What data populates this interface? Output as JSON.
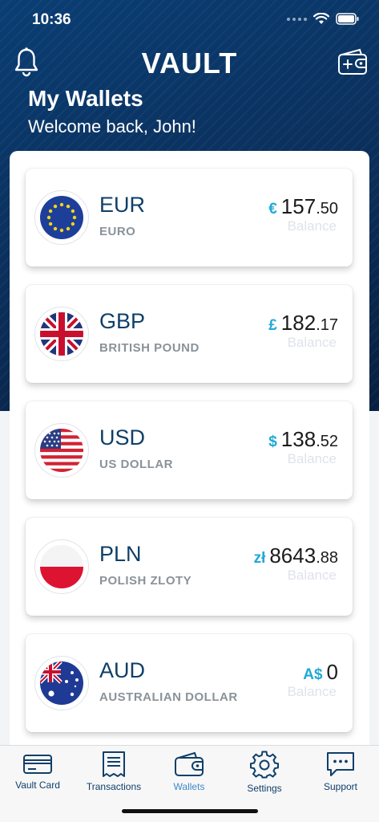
{
  "status_bar": {
    "time": "10:36"
  },
  "header": {
    "logo": "VAULT",
    "title": "My Wallets",
    "subtitle": "Welcome back, John!"
  },
  "wallets": [
    {
      "code": "EUR",
      "name": "EURO",
      "symbol": "€",
      "amount_major": "157",
      "amount_minor": ".50",
      "balance_label": "Balance",
      "flag_icon": "eu-flag-icon"
    },
    {
      "code": "GBP",
      "name": "BRITISH POUND",
      "symbol": "£",
      "amount_major": "182",
      "amount_minor": ".17",
      "balance_label": "Balance",
      "flag_icon": "uk-flag-icon"
    },
    {
      "code": "USD",
      "name": "US DOLLAR",
      "symbol": "$",
      "amount_major": "138",
      "amount_minor": ".52",
      "balance_label": "Balance",
      "flag_icon": "us-flag-icon"
    },
    {
      "code": "PLN",
      "name": "POLISH ZLOTY",
      "symbol": "zł",
      "amount_major": "8643",
      "amount_minor": ".88",
      "balance_label": "Balance",
      "flag_icon": "pl-flag-icon"
    },
    {
      "code": "AUD",
      "name": "AUSTRALIAN DOLLAR",
      "symbol": "A$",
      "amount_major": "0",
      "amount_minor": "",
      "balance_label": "Balance",
      "flag_icon": "au-flag-icon"
    }
  ],
  "tabbar": {
    "items": [
      {
        "label": "Vault Card",
        "icon": "card-icon",
        "active": false
      },
      {
        "label": "Transactions",
        "icon": "receipt-icon",
        "active": false
      },
      {
        "label": "Wallets",
        "icon": "wallet-icon",
        "active": true
      },
      {
        "label": "Settings",
        "icon": "gear-icon",
        "active": false
      },
      {
        "label": "Support",
        "icon": "chat-icon",
        "active": false
      }
    ]
  },
  "colors": {
    "brand_navy": "#0f3f68",
    "accent_cyan": "#20a9d6",
    "active_tab": "#3f88c5"
  }
}
